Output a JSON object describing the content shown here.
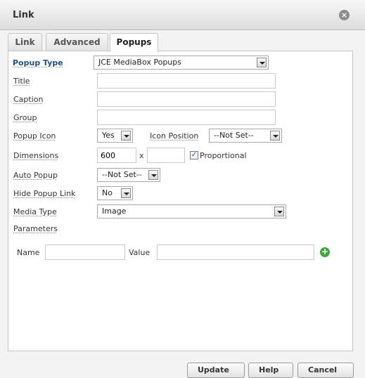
{
  "dialog": {
    "title": "Link",
    "close_icon": "×"
  },
  "tabs": [
    {
      "label": "Link",
      "active": false
    },
    {
      "label": "Advanced",
      "active": false
    },
    {
      "label": "Popups",
      "active": true
    }
  ],
  "form": {
    "popup_type": {
      "label": "Popup Type",
      "value": "JCE MediaBox Popups"
    },
    "title": {
      "label": "Title",
      "value": ""
    },
    "caption": {
      "label": "Caption",
      "value": ""
    },
    "group": {
      "label": "Group",
      "value": ""
    },
    "popup_icon": {
      "label": "Popup Icon",
      "value": "Yes"
    },
    "icon_position": {
      "label": "Icon Position",
      "value": "--Not Set--"
    },
    "dimensions": {
      "label": "Dimensions",
      "width": "600",
      "height": "",
      "separator": "x",
      "proportional_label": "Proportional",
      "proportional_checked": true
    },
    "auto_popup": {
      "label": "Auto Popup",
      "value": "--Not Set--"
    },
    "hide_popup_link": {
      "label": "Hide Popup Link",
      "value": "No"
    },
    "media_type": {
      "label": "Media Type",
      "value": "Image"
    },
    "parameters": {
      "label": "Parameters",
      "name_label": "Name",
      "value_label": "Value",
      "name_value": "",
      "value_value": "",
      "add_icon": "+"
    }
  },
  "footer": {
    "buttons": [
      "Update",
      "Help",
      "Cancel"
    ]
  },
  "colors": {
    "accent": "#1f4f85",
    "add": "#3aa93a"
  }
}
